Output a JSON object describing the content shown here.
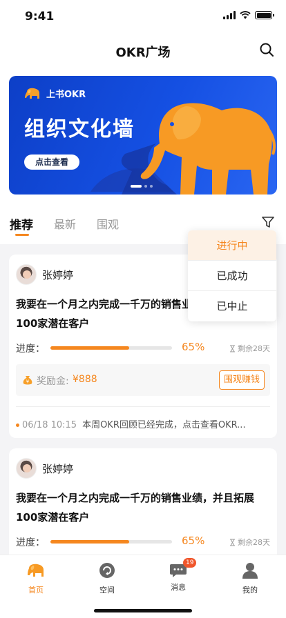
{
  "status": {
    "time": "9:41"
  },
  "nav": {
    "title": "OKR广场"
  },
  "banner": {
    "brand": "上书OKR",
    "title": "组织文化墙",
    "button": "点击查看"
  },
  "tabs": [
    {
      "label": "推荐",
      "active": true
    },
    {
      "label": "最新",
      "active": false
    },
    {
      "label": "围观",
      "active": false
    }
  ],
  "filter_menu": [
    {
      "label": "进行中",
      "active": true
    },
    {
      "label": "已成功",
      "active": false
    },
    {
      "label": "已中止",
      "active": false
    }
  ],
  "cards": [
    {
      "user": "张婷婷",
      "goal": "我要在一个月之内完成一千万的销售业绩，并且拓展100家潜在客户",
      "progress_label": "进度：",
      "progress": 65,
      "progress_text": "65%",
      "remaining": "剩余28天",
      "reward_label": "奖励金:",
      "reward_amount": "¥888",
      "earn_button": "围观赚钱",
      "update_time": "06/18 10:15",
      "update_text": "本周OKR回顾已经完成，点击查看OKR..."
    },
    {
      "user": "张婷婷",
      "goal": "我要在一个月之内完成一千万的销售业绩，并且拓展100家潜在客户",
      "progress_label": "进度：",
      "progress": 65,
      "progress_text": "65%",
      "remaining": "剩余28天"
    }
  ],
  "tabbar": [
    {
      "label": "首页",
      "icon": "elephant-icon",
      "active": true
    },
    {
      "label": "空间",
      "icon": "space-icon",
      "active": false
    },
    {
      "label": "消息",
      "icon": "message-icon",
      "active": false,
      "badge": "19"
    },
    {
      "label": "我的",
      "icon": "profile-icon",
      "active": false
    }
  ],
  "colors": {
    "accent": "#f5871f",
    "banner": "#1550e3",
    "badge": "#f0562b"
  }
}
